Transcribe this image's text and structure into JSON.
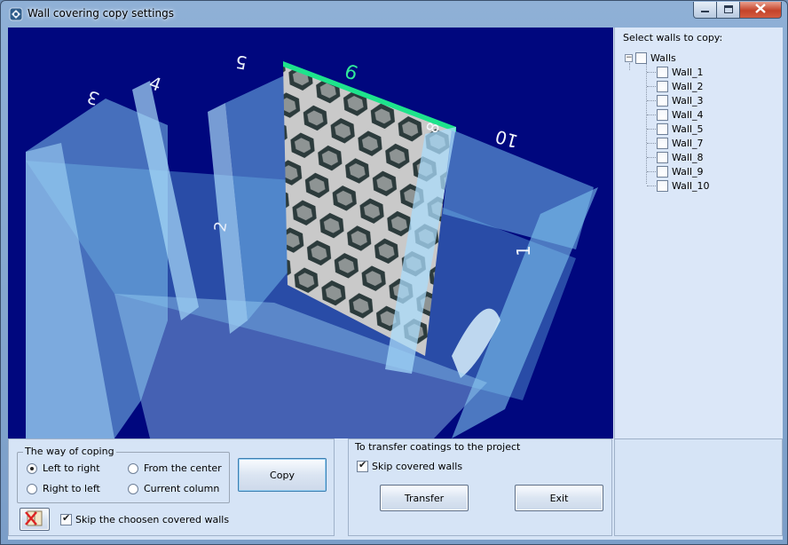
{
  "window": {
    "title": "Wall covering copy settings",
    "app_icon": "app-icon",
    "controls": [
      "minimize-icon",
      "maximize-icon",
      "close-icon"
    ]
  },
  "viewport": {
    "wall_labels": [
      "3",
      "4",
      "5",
      "6",
      "10",
      "8",
      "2",
      "1"
    ]
  },
  "tree": {
    "label": "Select walls to copy:",
    "root": {
      "label": "Walls",
      "expander": "−",
      "checked": false
    },
    "items": [
      {
        "label": "Wall_1",
        "checked": false
      },
      {
        "label": "Wall_2",
        "checked": false
      },
      {
        "label": "Wall_3",
        "checked": false
      },
      {
        "label": "Wall_4",
        "checked": false
      },
      {
        "label": "Wall_5",
        "checked": false
      },
      {
        "label": "Wall_7",
        "checked": false
      },
      {
        "label": "Wall_8",
        "checked": false
      },
      {
        "label": "Wall_9",
        "checked": false
      },
      {
        "label": "Wall_10",
        "checked": false
      }
    ]
  },
  "coping": {
    "title": "The way of coping",
    "options": [
      {
        "label": "Left to right",
        "checked": true
      },
      {
        "label": "From the center",
        "checked": false
      },
      {
        "label": "Right to left",
        "checked": false
      },
      {
        "label": "Current column",
        "checked": false
      }
    ],
    "copy_label": "Copy",
    "skip_label": "Skip the choosen covered walls",
    "skip_checked": true,
    "delete_icon": "delete-coverings-icon"
  },
  "transfer": {
    "title": "To transfer coatings to the project",
    "skip_label": "Skip covered walls",
    "skip_checked": true,
    "transfer_label": "Transfer",
    "exit_label": "Exit"
  },
  "colors": {
    "viewport_bg": "#00077e",
    "glass_wall": "#7fc4ee",
    "selected_edge": "#1ee38c"
  }
}
